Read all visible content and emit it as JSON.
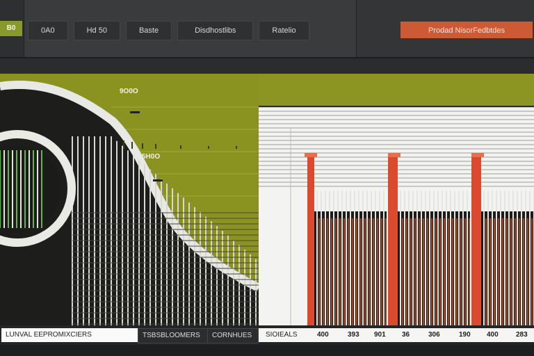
{
  "topbar": {
    "brand_label": "B0",
    "tabs": [
      "0A0",
      "Hd 50",
      "Baste",
      "Disdhostlibs",
      "Ratelio"
    ],
    "action_label": "Prodad NisorFedbtdes"
  },
  "left_chart": {
    "label_top": "9O0O",
    "label_mid": "5H0O"
  },
  "footer": {
    "tab_left": "LUNVAL EEPROMIXCIERS",
    "tab_mid_a": "TSBSBLOOMERS",
    "tab_mid_b": "CORNHUES",
    "axis_title": "SIOIEALS",
    "axis_values": [
      "400",
      "393",
      "901",
      "36",
      "306",
      "190",
      "400",
      "283"
    ]
  },
  "colors": {
    "olive": "#8c9522",
    "accent_orange": "#cc5a35",
    "bar_red": "#d94a2e",
    "panel_dark": "#2b2c2d"
  },
  "icons": [
    "chevron-marker-icon"
  ]
}
